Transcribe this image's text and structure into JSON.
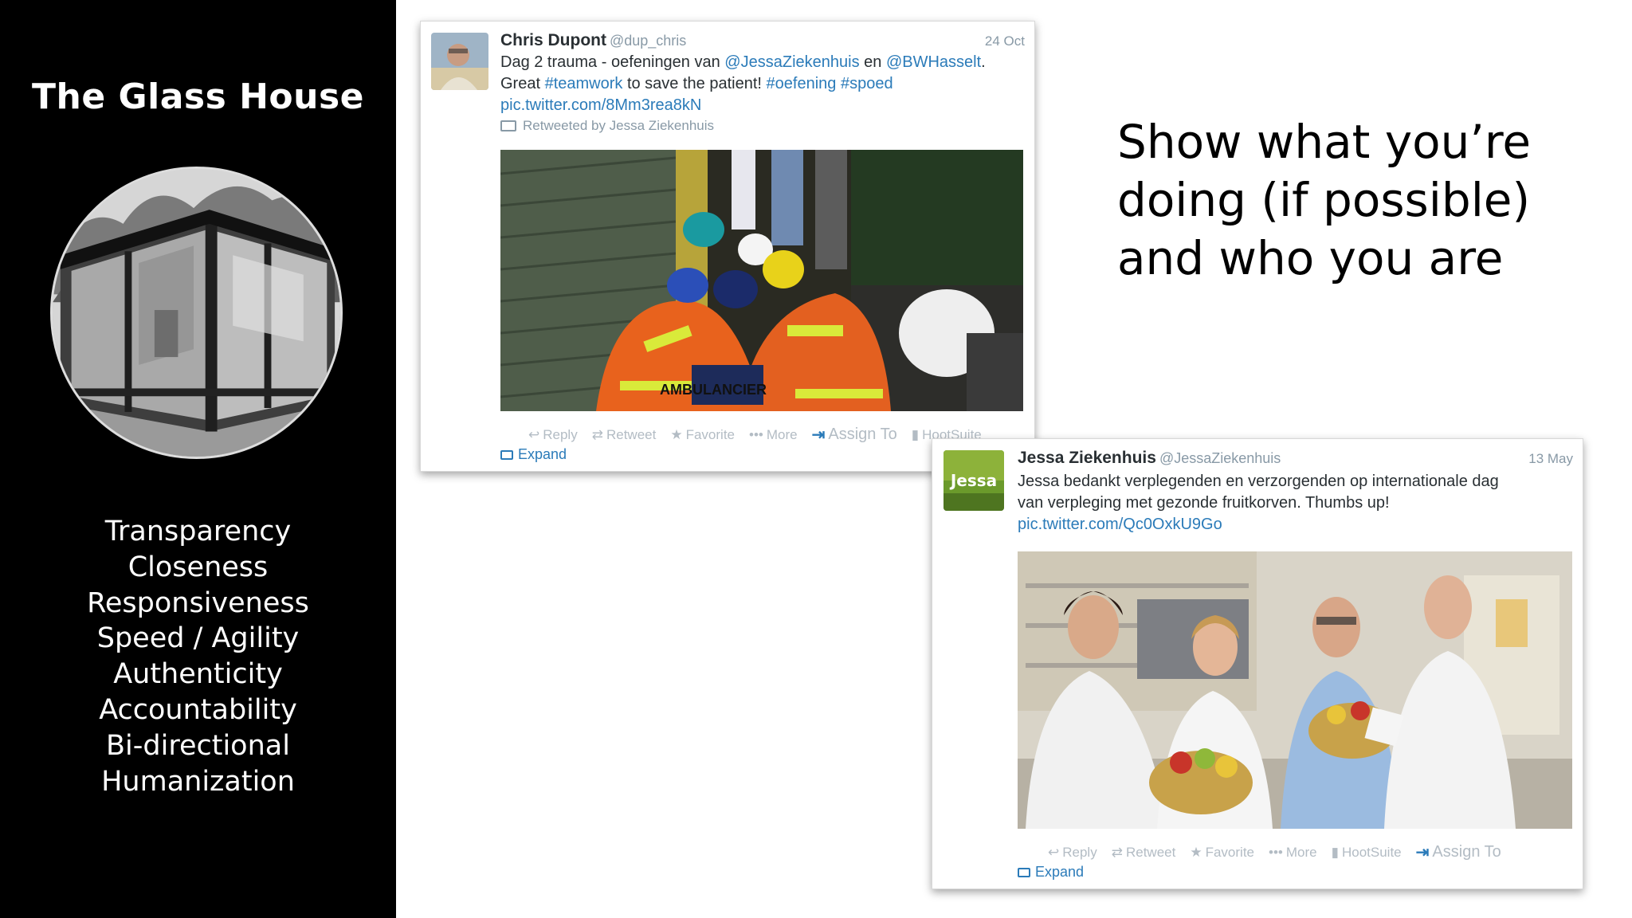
{
  "sidebar": {
    "title": "The Glass House",
    "values": [
      "Transparency",
      "Closeness",
      "Responsiveness",
      "Speed / Agility",
      "Authenticity",
      "Accountability",
      "Bi-directional",
      "Humanization"
    ]
  },
  "headline": {
    "line1": "Show what you’re",
    "line2": "doing (if possible)",
    "line3": "and who you are"
  },
  "tweet1": {
    "name": "Chris Dupont",
    "handle": "@dup_chris",
    "date": "24 Oct",
    "text_part1": "Dag 2 trauma - oefeningen van ",
    "mention1": "@JessaZiekenhuis",
    "text_part2": " en ",
    "mention2": "@BWHasselt",
    "text_part3": ".",
    "text_part4": "Great ",
    "hashtag1": "#teamwork",
    "text_part5": " to save the patient! ",
    "hashtag2": "#oefening",
    "hashtag3": "#spoed",
    "pic_link": "pic.twitter.com/8Mm3rea8kN",
    "retweeted_by": "Retweeted by Jessa Ziekenhuis",
    "photo_label": "AMBULANCIER",
    "actions": {
      "reply": "Reply",
      "retweet": "Retweet",
      "favorite": "Favorite",
      "more": "More",
      "assign": "Assign To",
      "hootsuite": "HootSuite"
    },
    "expand": "Expand"
  },
  "tweet2": {
    "name": "Jessa Ziekenhuis",
    "handle": "@JessaZiekenhuis",
    "date": "13 May",
    "avatar_text": "Jessa",
    "text_line1": "Jessa bedankt verplegenden en verzorgenden op internationale dag",
    "text_line2": "van verpleging met gezonde fruitkorven. Thumbs up!",
    "pic_link": "pic.twitter.com/Qc0OxkU9Go",
    "actions": {
      "reply": "Reply",
      "retweet": "Retweet",
      "favorite": "Favorite",
      "more": "More",
      "hootsuite": "HootSuite",
      "assign": "Assign To"
    },
    "expand": "Expand"
  },
  "colors": {
    "sidebar_bg": "#000000",
    "twitter_link": "#2b7bb9",
    "muted": "#8899a6"
  }
}
